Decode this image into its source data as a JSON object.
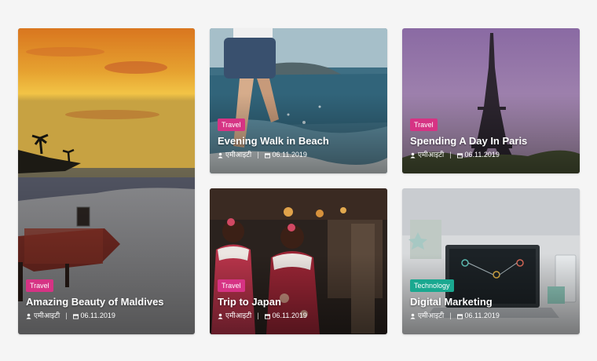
{
  "colors": {
    "travel_badge": "#d63384",
    "technology_badge": "#1aa890"
  },
  "posts": [
    {
      "category": "Travel",
      "title": "Amazing Beauty of Maldives",
      "author": "एमीआइटी",
      "date": "06.11.2019"
    },
    {
      "category": "Travel",
      "title": "Evening Walk in Beach",
      "author": "एमीआइटी",
      "date": "06.11.2019"
    },
    {
      "category": "Travel",
      "title": "Spending A Day In Paris",
      "author": "एमीआइटी",
      "date": "06.11.2019"
    },
    {
      "category": "Travel",
      "title": "Trip to Japan",
      "author": "एमीआइटी",
      "date": "06.11.2019"
    },
    {
      "category": "Technology",
      "title": "Digital Marketing",
      "author": "एमीआइटी",
      "date": "06.11.2019"
    }
  ]
}
